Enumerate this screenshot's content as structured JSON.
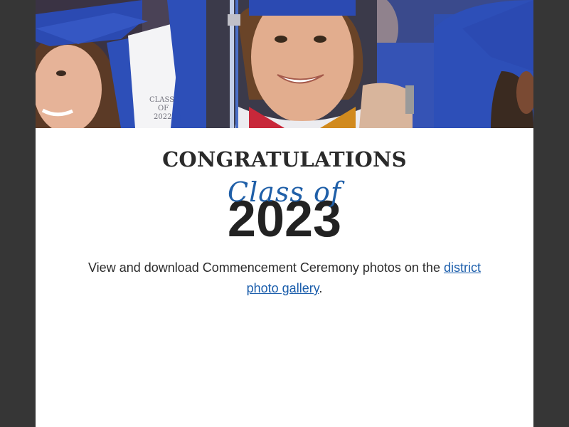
{
  "hero": {
    "alt": "Graduates in blue caps and gowns smiling at commencement",
    "gown_text": [
      "CLASS",
      "OF",
      "2022"
    ],
    "colors": {
      "gown_blue": "#2d4fb8",
      "cap_blue": "#2b4ab2",
      "skin": "#e2ad8e",
      "hair": "#6a4428"
    }
  },
  "heading": {
    "congratulations": "CONGRATULATIONS",
    "class_of": "Class of",
    "year": "2023"
  },
  "message": {
    "text_before": "View and download Commencement Ceremony photos on the ",
    "link_text": "district photo gallery",
    "text_after": "."
  },
  "colors": {
    "background": "#363636",
    "card": "#ffffff",
    "script_blue": "#1f5fa8",
    "link": "#1a5dab",
    "text": "#2b2b2b"
  }
}
